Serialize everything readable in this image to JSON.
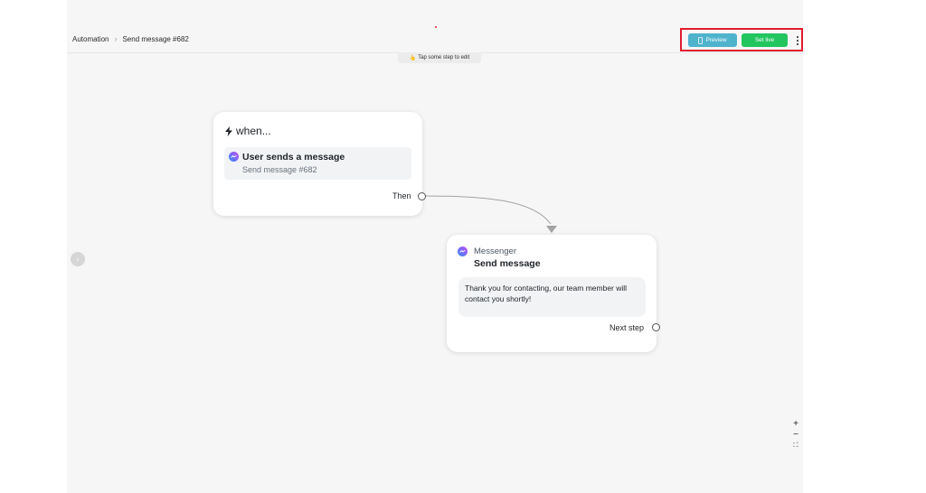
{
  "breadcrumb": {
    "root": "Automation",
    "current": "Send message #682"
  },
  "toolbar": {
    "preview_label": "Preview",
    "set_live_label": "Set live",
    "more_icon": "more-vertical-icon"
  },
  "hint": {
    "emoji": "👆",
    "text": "Tap some step to edit"
  },
  "trigger_node": {
    "header": "when...",
    "header_icon": "lightning-icon",
    "trigger_icon": "messenger-icon",
    "trigger_title": "User sends a message",
    "trigger_subtitle": "Send message #682",
    "output_label": "Then"
  },
  "message_node": {
    "platform_icon": "messenger-icon",
    "platform": "Messenger",
    "title": "Send message",
    "message": "Thank you for contacting, our team member will contact you shortly!",
    "output_label": "Next step"
  },
  "zoom_controls": {
    "zoom_in": "+",
    "zoom_out": "−",
    "fit": "⛶"
  },
  "colors": {
    "canvas": "#f6f6f6",
    "preview_button": "#4fb3cc",
    "live_button": "#22c55e",
    "highlight_border": "#e11d2e",
    "messenger_gradient_start": "#2e8bff",
    "messenger_gradient_end": "#c34bf0"
  }
}
